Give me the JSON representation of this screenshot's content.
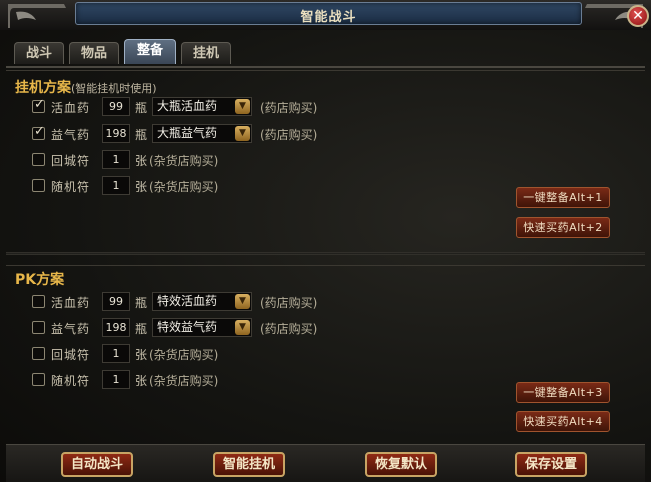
{
  "window": {
    "title": "智能战斗",
    "close_label": "✕"
  },
  "tabs": [
    "战斗",
    "物品",
    "整备",
    "挂机"
  ],
  "sections": [
    {
      "title": "挂机方案",
      "note": "(智能挂机时使用)",
      "rows": [
        {
          "checked": true,
          "label": "活血药",
          "qty": "99",
          "unit": "瓶",
          "select": "大瓶活血药",
          "note": "(药店购买)"
        },
        {
          "checked": true,
          "label": "益气药",
          "qty": "198",
          "unit": "瓶",
          "select": "大瓶益气药",
          "note": "(药店购买)"
        },
        {
          "checked": false,
          "label": "回城符",
          "qty": "1",
          "unit": "张",
          "note": "(杂货店购买)"
        },
        {
          "checked": false,
          "label": "随机符",
          "qty": "1",
          "unit": "张",
          "note": "(杂货店购买)"
        }
      ],
      "buttons": [
        "一键整备Alt+1",
        "快速买药Alt+2"
      ]
    },
    {
      "title": "PK方案",
      "note": "",
      "rows": [
        {
          "checked": false,
          "label": "活血药",
          "qty": "99",
          "unit": "瓶",
          "select": "特效活血药",
          "note": "(药店购买)"
        },
        {
          "checked": false,
          "label": "益气药",
          "qty": "198",
          "unit": "瓶",
          "select": "特效益气药",
          "note": "(药店购买)"
        },
        {
          "checked": false,
          "label": "回城符",
          "qty": "1",
          "unit": "张",
          "note": "(杂货店购买)"
        },
        {
          "checked": false,
          "label": "随机符",
          "qty": "1",
          "unit": "张",
          "note": "(杂货店购买)"
        }
      ],
      "buttons": [
        "一键整备Alt+3",
        "快速买药Alt+4"
      ]
    }
  ],
  "bottom_buttons": [
    "自动战斗",
    "智能挂机",
    "恢复默认",
    "保存设置"
  ],
  "colors": {
    "accent": "#e8b74a",
    "button": "#7a2a16",
    "tab_active": "#5f6f82"
  }
}
